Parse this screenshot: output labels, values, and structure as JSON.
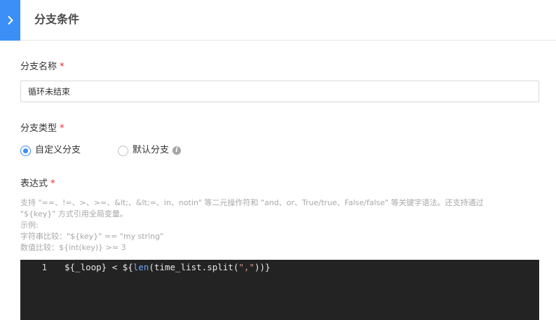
{
  "header": {
    "title": "分支条件"
  },
  "form": {
    "name": {
      "label": "分支名称",
      "required_mark": "*",
      "value": "循环未结束"
    },
    "type": {
      "label": "分支类型",
      "required_mark": "*",
      "options": [
        {
          "label": "自定义分支",
          "selected": true
        },
        {
          "label": "默认分支",
          "selected": false
        }
      ]
    },
    "expression": {
      "label": "表达式",
      "required_mark": "*",
      "help_lines": [
        "支持 \"==、!=、>、>=、&lt;、&lt;=、in、notin\" 等二元操作符和 \"and、or、True/true、False/false\" 等关键字语法。还支持通过",
        "\"${key}\" 方式引用全局变量。",
        "示例:",
        "字符串比较：\"${key}\" == \"my string\"",
        "数值比较：${int(key)} >= 3"
      ],
      "editor": {
        "line_number": "1",
        "code_prefix": "${_loop} < ${",
        "code_fn": "len",
        "code_mid": "(time_list.split(",
        "code_str": "\",\"",
        "code_suffix": "))}"
      }
    }
  },
  "colors": {
    "accent": "#3b8ff6",
    "required": "#f5222d",
    "editor_bg": "#232323"
  }
}
